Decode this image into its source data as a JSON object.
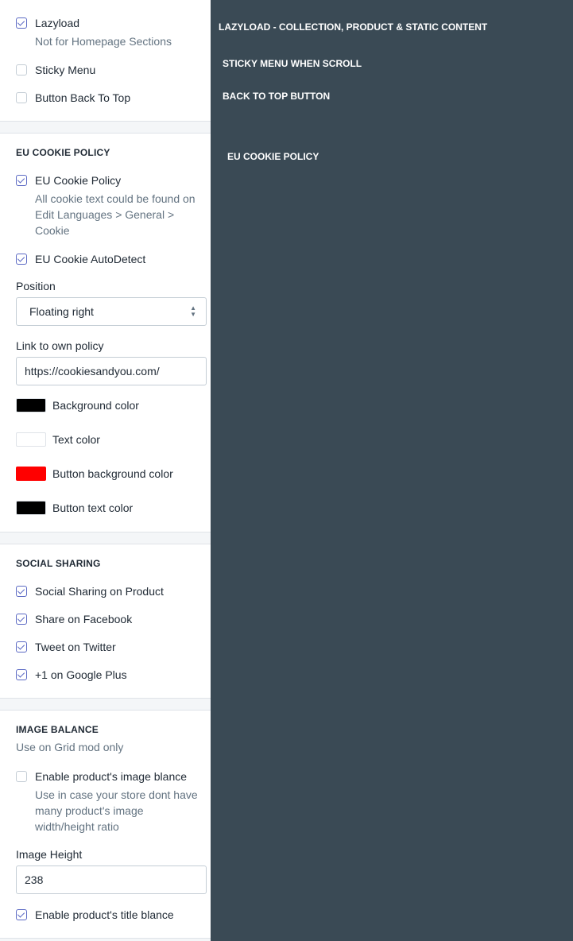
{
  "lazyload": {
    "checked": true,
    "label": "Lazyload",
    "help": "Not for Homepage Sections"
  },
  "sticky_menu": {
    "checked": false,
    "label": "Sticky Menu"
  },
  "back_to_top": {
    "checked": false,
    "label": "Button Back To Top"
  },
  "eu_cookie": {
    "title": "EU COOKIE POLICY",
    "policy_checkbox": {
      "checked": true,
      "label": "EU Cookie Policy",
      "help": "All cookie text could be found on Edit Languages > General > Cookie"
    },
    "autodetect": {
      "checked": true,
      "label": "EU Cookie AutoDetect"
    },
    "position_label": "Position",
    "position_value": "Floating right",
    "link_label": "Link to own policy",
    "link_value": "https://cookiesandyou.com/",
    "colors": [
      {
        "label": "Background color",
        "hex": "#000000"
      },
      {
        "label": "Text color",
        "hex": "#ffffff"
      },
      {
        "label": "Button background color",
        "hex": "#ff0000"
      },
      {
        "label": "Button text color",
        "hex": "#000000"
      }
    ]
  },
  "social": {
    "title": "SOCIAL SHARING",
    "items": [
      {
        "checked": true,
        "label": "Social Sharing on Product"
      },
      {
        "checked": true,
        "label": "Share on Facebook"
      },
      {
        "checked": true,
        "label": "Tweet on Twitter"
      },
      {
        "checked": true,
        "label": "+1 on Google Plus"
      }
    ]
  },
  "image_balance": {
    "title": "IMAGE BALANCE",
    "subtitle": "Use on Grid mod only",
    "enable_image": {
      "checked": false,
      "label": "Enable product's image blance",
      "help": "Use in case your store dont have many product's image width/height ratio"
    },
    "height_label": "Image Height",
    "height_value": "238",
    "enable_title": {
      "checked": true,
      "label": "Enable product's title blance"
    }
  },
  "preview": {
    "lazyload": "LAZYLOAD - COLLECTION, PRODUCT & STATIC CONTENT",
    "sticky": "STICKY MENU WHEN SCROLL",
    "back_top": "BACK  TO TOP BUTTON",
    "cookie": "EU COOKIE POLICY"
  },
  "colors": {
    "preview_bg": "#3a4a55",
    "accent": "#5c6ac4"
  }
}
